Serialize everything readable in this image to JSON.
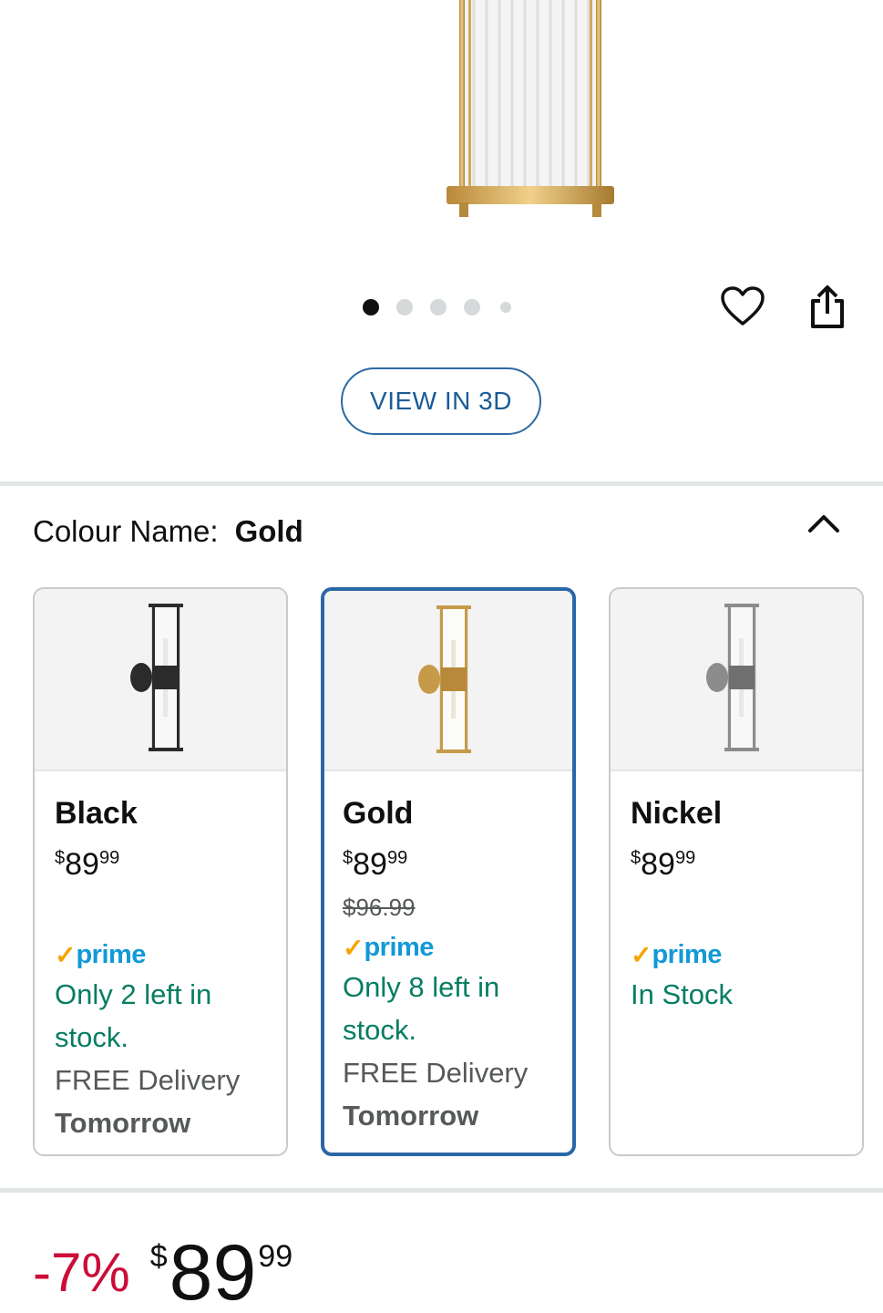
{
  "gallery": {
    "dots_total": 5,
    "active_dot": 0,
    "favorite_icon": "heart-icon",
    "share_icon": "share-icon",
    "view_3d_label": "VIEW IN 3D"
  },
  "colour": {
    "label": "Colour Name:",
    "selected": "Gold",
    "collapse_icon": "chevron-up-icon"
  },
  "variants": [
    {
      "name": "Black",
      "price_currency": "$",
      "price_whole": "89",
      "price_cents": "99",
      "list_price": "",
      "prime": "prime",
      "stock": "Only 2 left in stock.",
      "delivery": "FREE Delivery",
      "delivery_day": "Tomorrow",
      "selected": false,
      "finish_color": "#2b2b2b"
    },
    {
      "name": "Gold",
      "price_currency": "$",
      "price_whole": "89",
      "price_cents": "99",
      "list_price": "$96.99",
      "prime": "prime",
      "stock": "Only 8 left in stock.",
      "delivery": "FREE Delivery",
      "delivery_day": "Tomorrow",
      "selected": true,
      "finish_color": "#c79a4a"
    },
    {
      "name": "Nickel",
      "price_currency": "$",
      "price_whole": "89",
      "price_cents": "99",
      "list_price": "",
      "prime": "prime",
      "stock": "In Stock",
      "delivery": "",
      "delivery_day": "",
      "selected": false,
      "finish_color": "#8c8c8c"
    }
  ],
  "price": {
    "discount": "-7%",
    "currency": "$",
    "whole": "89",
    "cents": "99"
  },
  "colors": {
    "accent_blue": "#2a67a7",
    "prime_blue": "#1399d6",
    "prime_check": "#f7a300",
    "stock_green": "#067d62",
    "discount_red": "#cc0c39"
  }
}
